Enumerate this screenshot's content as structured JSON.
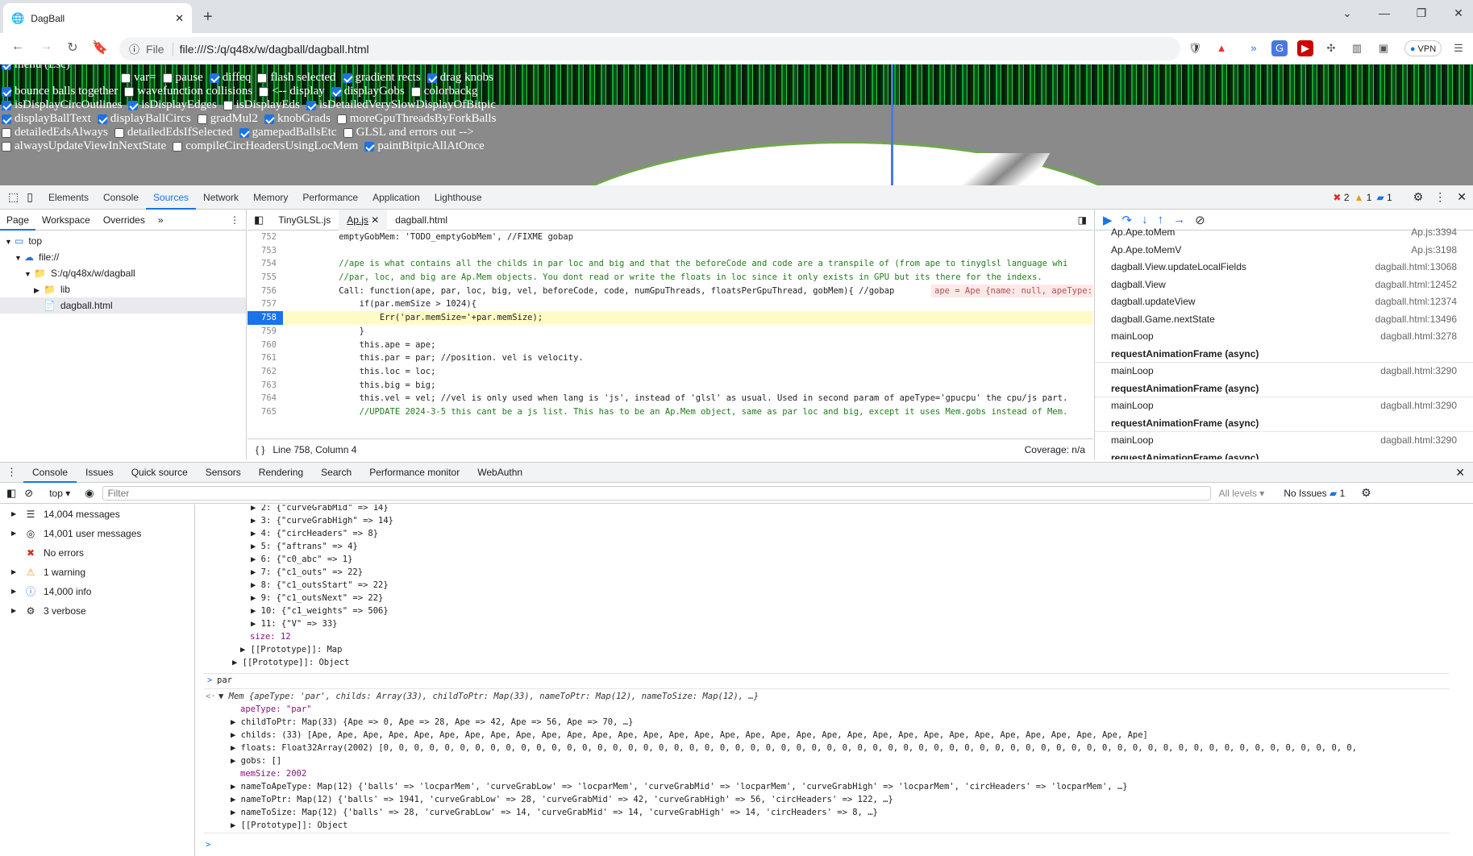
{
  "browser": {
    "tab_title": "DagBall",
    "url_scheme": "File",
    "url": "file:///S:/q/q48x/w/dagball/dagball.html",
    "vpn_label": "VPN"
  },
  "page": {
    "rows": [
      [
        {
          "label": "menu (Esc)",
          "on": true
        }
      ],
      [
        {
          "label": "var=",
          "on": false
        },
        {
          "label": "pause",
          "on": false
        },
        {
          "label": "diffeq",
          "on": true
        },
        {
          "label": "flash selected",
          "on": false
        },
        {
          "label": "gradient rects",
          "on": true
        },
        {
          "label": "drag knobs",
          "on": true
        }
      ],
      [
        {
          "label": "bounce balls together",
          "on": true
        },
        {
          "label": "wavefunction collisions",
          "on": false
        },
        {
          "label": "<-- display",
          "on": false
        },
        {
          "label": "displayGobs",
          "on": true
        },
        {
          "label": "colorbackg",
          "on": false
        }
      ],
      [
        {
          "label": "isDisplayCircOutlines",
          "on": true
        },
        {
          "label": "isDisplayEdges",
          "on": true
        },
        {
          "label": "isDisplayEds",
          "on": false
        },
        {
          "label": "isDetailedVerySlowDisplayOfBitpic",
          "on": true
        }
      ],
      [
        {
          "label": "displayBallText",
          "on": true
        },
        {
          "label": "displayBallCircs",
          "on": true
        },
        {
          "label": "gradMul2",
          "on": false
        },
        {
          "label": "knobGrads",
          "on": true
        },
        {
          "label": "moreGpuThreadsByForkBalls",
          "on": false
        }
      ],
      [
        {
          "label": "detailedEdsAlways",
          "on": false
        },
        {
          "label": "detailedEdsIfSelected",
          "on": false
        },
        {
          "label": "gamepadBallsEtc",
          "on": true
        },
        {
          "label": "GLSL and errors out -->",
          "on": false
        }
      ],
      [
        {
          "label": "alwaysUpdateViewInNextState",
          "on": false
        },
        {
          "label": "compileCircHeadersUsingLocMem",
          "on": false
        },
        {
          "label": "paintBitpicAllAtOnce",
          "on": true
        }
      ]
    ]
  },
  "devtools": {
    "tabs": [
      "Elements",
      "Console",
      "Sources",
      "Network",
      "Memory",
      "Performance",
      "Application",
      "Lighthouse"
    ],
    "selected_tab": "Sources",
    "errors": "2",
    "warnings": "1",
    "messages": "1",
    "nav_tabs": [
      "Page",
      "Workspace",
      "Overrides"
    ],
    "tree": [
      "top",
      "file://",
      "S:/q/q48x/w/dagball",
      "lib",
      "dagball.html"
    ],
    "editor_tabs": [
      "TinyGLSL.js",
      "Ap.js",
      "dagball.html"
    ],
    "code_lines": [
      {
        "n": "752",
        "t": "    emptyGobMem: 'TODO_emptyGobMem', //FIXME gobap"
      },
      {
        "n": "753",
        "t": ""
      },
      {
        "n": "754",
        "t": "    //ape is what contains all the childs in par loc and big and that the beforeCode and code are a transpile of (from ape to tinyglsl language whi"
      },
      {
        "n": "755",
        "t": "    //par, loc, and big are Ap.Mem objects. You dont read or write the floats in loc since it only exists in GPU but its there for the indexs."
      },
      {
        "n": "756",
        "t": "    Call: function(ape, par, loc, big, vel, beforeCode, code, numGpuThreads, floatsPerGpuThread, gobMem){ //gobap"
      },
      {
        "n": "757",
        "t": "        if(par.memSize > 1024){"
      },
      {
        "n": "758",
        "t": "            Err('par.memSize='+par.memSize);"
      },
      {
        "n": "759",
        "t": "        }"
      },
      {
        "n": "760",
        "t": "        this.ape = ape;"
      },
      {
        "n": "761",
        "t": "        this.par = par; //position. vel is velocity."
      },
      {
        "n": "762",
        "t": "        this.loc = loc;"
      },
      {
        "n": "763",
        "t": "        this.big = big;"
      },
      {
        "n": "764",
        "t": "        this.vel = vel; //vel is only used when lang is 'js', instead of 'glsl' as usual. Used in second param of apeType='gpucpu' the cpu/js part."
      },
      {
        "n": "765",
        "t": "        //UPDATE 2024-3-5 this cant be a js list. This has to be an Ap.Mem object, same as par loc and big, except it uses Mem.gobs instead of Mem."
      }
    ],
    "inline_value": "ape = Ape {name: null, apeType:",
    "status_position": "Line 758, Column 4",
    "coverage": "Coverage: n/a",
    "call_stack": [
      {
        "fn": "Ap.Ape.toMem",
        "loc": "Ap.js:3394",
        "async": false
      },
      {
        "fn": "Ap.Ape.toMemV",
        "loc": "Ap.js:3198",
        "async": false
      },
      {
        "fn": "dagball.View.updateLocalFields",
        "loc": "dagball.html:13068",
        "async": false
      },
      {
        "fn": "dagball.View",
        "loc": "dagball.html:12452",
        "async": false
      },
      {
        "fn": "dagball.updateView",
        "loc": "dagball.html:12374",
        "async": false
      },
      {
        "fn": "dagball.Game.nextState",
        "loc": "dagball.html:13496",
        "async": false
      },
      {
        "fn": "mainLoop",
        "loc": "dagball.html:3278",
        "async": false
      },
      {
        "fn": "requestAnimationFrame (async)",
        "loc": "",
        "async": true
      },
      {
        "fn": "mainLoop",
        "loc": "dagball.html:3290",
        "async": false
      },
      {
        "fn": "requestAnimationFrame (async)",
        "loc": "",
        "async": true
      },
      {
        "fn": "mainLoop",
        "loc": "dagball.html:3290",
        "async": false
      },
      {
        "fn": "requestAnimationFrame (async)",
        "loc": "",
        "async": true
      },
      {
        "fn": "mainLoop",
        "loc": "dagball.html:3290",
        "async": false
      },
      {
        "fn": "requestAnimationFrame (async)",
        "loc": "",
        "async": true
      }
    ],
    "drawer_tabs": [
      "Console",
      "Issues",
      "Quick source",
      "Sensors",
      "Rendering",
      "Search",
      "Performance monitor",
      "WebAuthn"
    ],
    "context": "top",
    "filter_placeholder": "Filter",
    "levels": "All levels",
    "issues": "No Issues",
    "issues_count": "1",
    "sidebar": [
      {
        "label": "14,004 messages",
        "icon": "list-icon"
      },
      {
        "label": "14,001 user messages",
        "icon": "user-icon"
      },
      {
        "label": "No errors",
        "icon": "error-icon"
      },
      {
        "label": "1 warning",
        "icon": "warning-icon"
      },
      {
        "label": "14,000 info",
        "icon": "info-icon"
      },
      {
        "label": "3 verbose",
        "icon": "bug-icon"
      }
    ],
    "log_lines": [
      "▶ 2: {\"curveGrabMid\" => 14}",
      "▶ 3: {\"curveGrabHigh\" => 14}",
      "▶ 4: {\"circHeaders\" => 8}",
      "▶ 5: {\"aftrans\" => 4}",
      "▶ 6: {\"c0_abc\" => 1}",
      "▶ 7: {\"c1_outs\" => 22}",
      "▶ 8: {\"c1_outsStart\" => 22}",
      "▶ 9: {\"c1_outsNext\" => 22}",
      "▶ 10: {\"c1_weights\" => 506}",
      "▶ 11: {\"V\" => 33}",
      "size: 12",
      "▶ [[Prototype]]: Map",
      "▶ [[Prototype]]: Object"
    ],
    "input_cmd": "par",
    "mem_summary": "▼ Mem {apeType: 'par', childs: Array(33), childToPtr: Map(33), nameToPtr: Map(12), nameToSize: Map(12), …}",
    "mem_fields": [
      "apeType: \"par\"",
      "▶ childToPtr: Map(33) {Ape => 0, Ape => 28, Ape => 42, Ape => 56, Ape => 70, …}",
      "▶ childs: (33) [Ape, Ape, Ape, Ape, Ape, Ape, Ape, Ape, Ape, Ape, Ape, Ape, Ape, Ape, Ape, Ape, Ape, Ape, Ape, Ape, Ape, Ape, Ape, Ape, Ape, Ape, Ape, Ape, Ape, Ape, Ape, Ape, Ape]",
      "▶ floats: Float32Array(2002) [0, 0, 0, 0, 0, 0, 0, 0, 0, 0, 0, 0, 0, 0, 0, 0, 0, 0, 0, 0, 0, 0, 0, 0, 0, 0, 0, 0, 0, 0, 0, 0, 0, 0, 0, 0, 0, 0, 0, 0, 0, 0, 0, 0, 0, 0, 0, 0, 0, 0, 0, 0, 0, 0, 0, 0, 0, 0, 0, 0, 0, 0, 0, 0,",
      "▶ gobs: []",
      "memSize: 2002",
      "▶ nameToApeType: Map(12) {'balls' => 'locparMem', 'curveGrabLow' => 'locparMem', 'curveGrabMid' => 'locparMem', 'curveGrabHigh' => 'locparMem', 'circHeaders' => 'locparMem', …}",
      "▶ nameToPtr: Map(12) {'balls' => 1941, 'curveGrabLow' => 28, 'curveGrabMid' => 42, 'curveGrabHigh' => 56, 'circHeaders' => 122, …}",
      "▶ nameToSize: Map(12) {'balls' => 28, 'curveGrabLow' => 14, 'curveGrabMid' => 14, 'curveGrabHigh' => 14, 'circHeaders' => 8, …}",
      "▶ [[Prototype]]: Object"
    ]
  }
}
